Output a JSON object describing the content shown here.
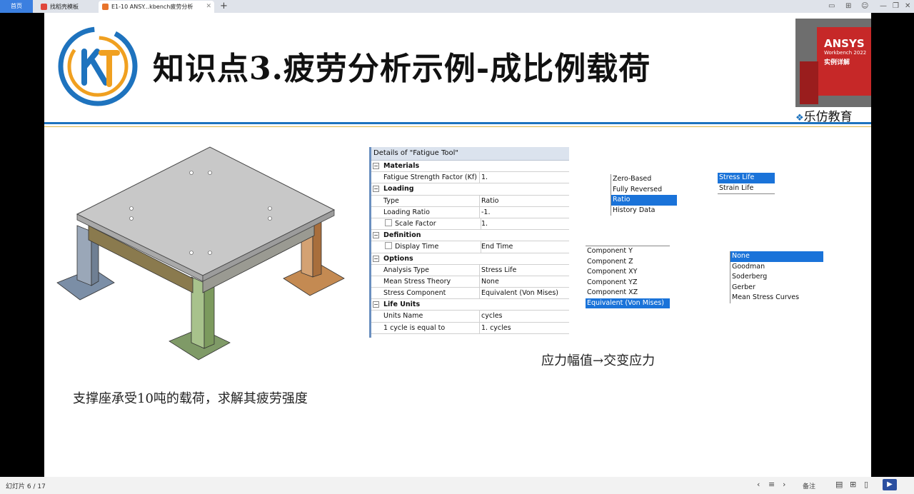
{
  "browser": {
    "tabs": [
      {
        "label": "首页",
        "active": false
      },
      {
        "label": "找稻壳模板",
        "active": false
      },
      {
        "label": "E1-10 ANSY...kbench疲劳分析",
        "active": true
      }
    ],
    "new_tab": "+"
  },
  "slide": {
    "title": "知识点3.疲劳分析示例-成比例载荷",
    "brand": "乐仿教育",
    "cover_text": "ANSYS",
    "cover_sub": "Workbench 2022",
    "cover_sub2": "实例详解",
    "caption": "支撑座承受10吨的载荷，求解其疲劳强度",
    "note": "应力幅值→交变应力"
  },
  "details": {
    "title": "Details of \"Fatigue Tool\"",
    "rows": [
      {
        "key": "Materials",
        "section": true
      },
      {
        "key": "Fatigue Strength Factor (Kf)",
        "value": "1."
      },
      {
        "key": "Loading",
        "section": true
      },
      {
        "key": "Type",
        "value": "Ratio"
      },
      {
        "key": "Loading Ratio",
        "value": "-1."
      },
      {
        "key": "Scale Factor",
        "value": "1.",
        "checkbox": true
      },
      {
        "key": "Definition",
        "section": true
      },
      {
        "key": "Display Time",
        "value": "End Time",
        "checkbox": true
      },
      {
        "key": "Options",
        "section": true
      },
      {
        "key": "Analysis Type",
        "value": "Stress Life"
      },
      {
        "key": "Mean Stress Theory",
        "value": "None"
      },
      {
        "key": "Stress Component",
        "value": "Equivalent (Von Mises)"
      },
      {
        "key": "Life Units",
        "section": true
      },
      {
        "key": "Units Name",
        "value": "cycles"
      },
      {
        "key": "1 cycle is equal to",
        "value": "1. cycles"
      }
    ]
  },
  "type_options": [
    "Zero-Based",
    "Fully Reversed",
    "Ratio",
    "History Data"
  ],
  "type_selected": "Ratio",
  "analysis_options": [
    "Stress Life",
    "Strain Life"
  ],
  "analysis_selected": "Stress Life",
  "component_options": [
    "Component Y",
    "Component Z",
    "Component XY",
    "Component YZ",
    "Component XZ",
    "Equivalent (Von Mises)"
  ],
  "component_selected": "Equivalent (Von Mises)",
  "mean_stress_options": [
    "None",
    "Goodman",
    "Soderberg",
    "Gerber",
    "Mean Stress Curves"
  ],
  "mean_stress_selected": "None",
  "status": {
    "slide_number": "幻灯片 6 / 17",
    "notes": "备注"
  },
  "colors": {
    "accent": "#1e73be",
    "selection": "#1a73d9",
    "gold_rule": "#e0b74a"
  }
}
